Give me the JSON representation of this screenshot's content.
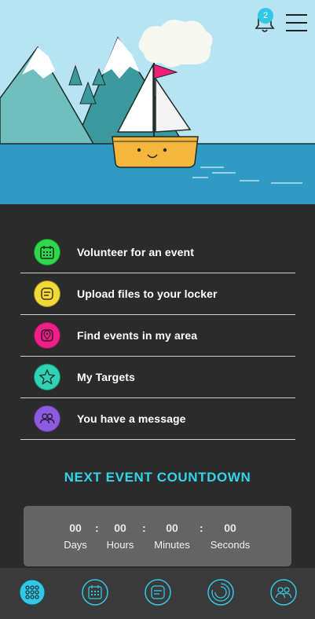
{
  "header": {
    "notification_count": "2",
    "icons": [
      "bell-icon",
      "hamburger-menu-icon"
    ]
  },
  "hero": {
    "illustration": "sailboat-on-lake-with-mountains"
  },
  "menu": {
    "items": [
      {
        "label": "Volunteer for an event",
        "icon": "calendar-icon",
        "color": "#2ed84a"
      },
      {
        "label": "Upload files to your locker",
        "icon": "locker-icon",
        "color": "#f2d93a"
      },
      {
        "label": "Find events in my area",
        "icon": "map-pin-icon",
        "color": "#ee1f88"
      },
      {
        "label": "My Targets",
        "icon": "star-icon",
        "color": "#2fd3b4"
      },
      {
        "label": "You have a message",
        "icon": "people-icon",
        "color": "#8c5be0"
      }
    ]
  },
  "countdown": {
    "title": "NEXT EVENT COUNTDOWN",
    "days_value": "00",
    "days_label": "Days",
    "hours_value": "00",
    "hours_label": "Hours",
    "minutes_value": "00",
    "minutes_label": "Minutes",
    "seconds_value": "00",
    "seconds_label": "Seconds",
    "separator": ":"
  },
  "bottom_nav": {
    "items": [
      "home-grid-icon",
      "calendar-icon",
      "locker-icon",
      "targets-icon",
      "people-icon"
    ],
    "accent": "#33c7e6"
  }
}
